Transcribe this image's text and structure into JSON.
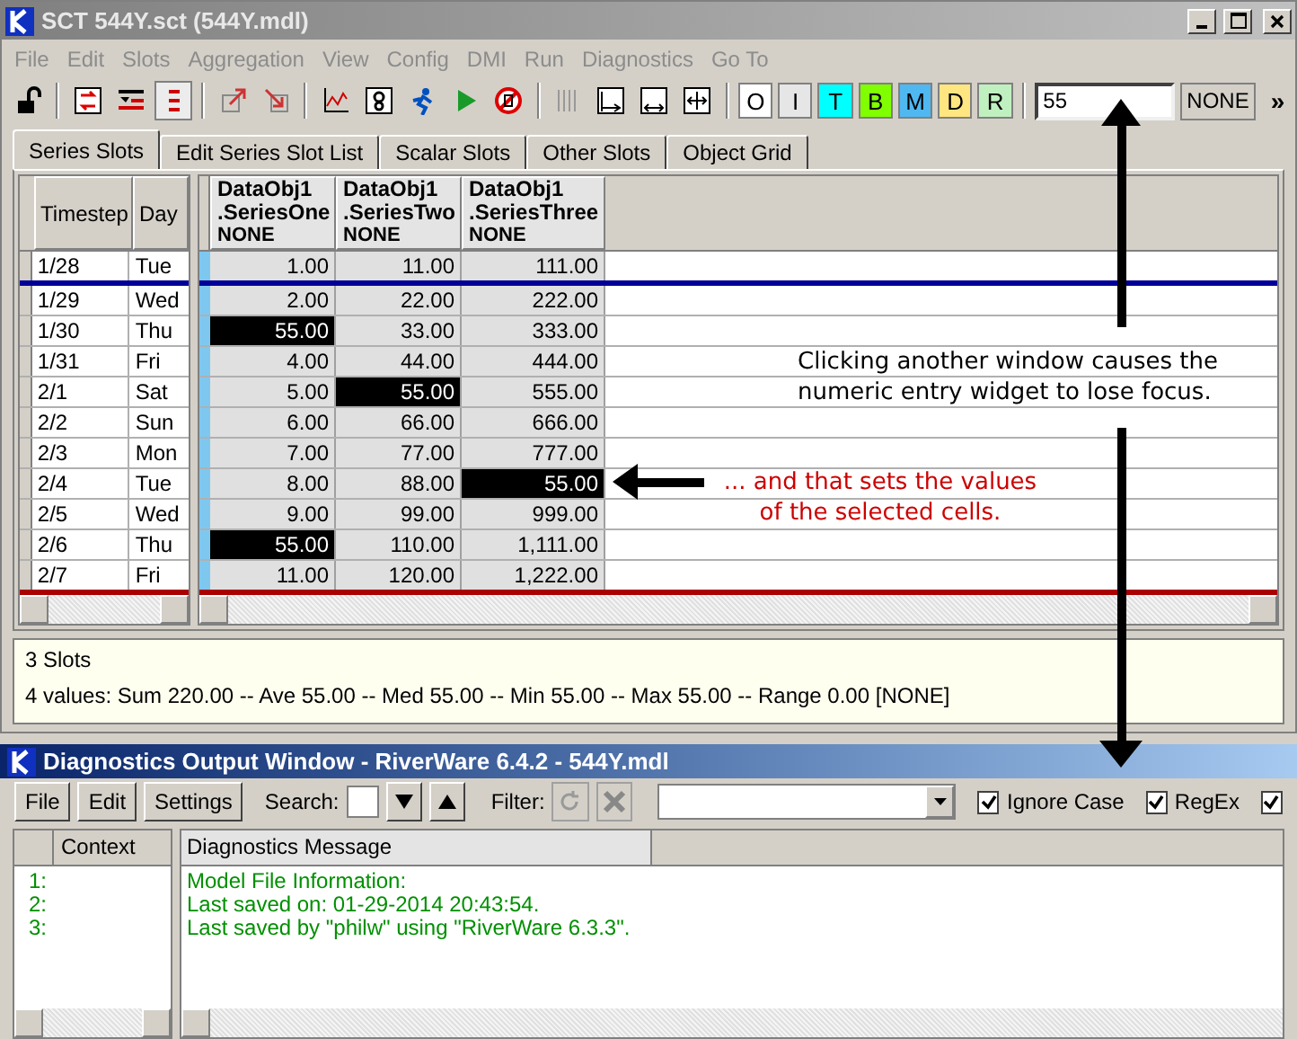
{
  "window": {
    "title": "SCT 544Y.sct (544Y.mdl)"
  },
  "menu": [
    {
      "label": "File",
      "disabled": true
    },
    {
      "label": "Edit",
      "disabled": true
    },
    {
      "label": "Slots",
      "disabled": true
    },
    {
      "label": "Aggregation",
      "disabled": true
    },
    {
      "label": "View",
      "disabled": true
    },
    {
      "label": "Config",
      "disabled": true
    },
    {
      "label": "DMI",
      "disabled": true
    },
    {
      "label": "Run",
      "disabled": true
    },
    {
      "label": "Diagnostics",
      "disabled": true
    },
    {
      "label": "Go To",
      "disabled": true
    }
  ],
  "flag_buttons": [
    {
      "label": "O",
      "color": "#ffffff"
    },
    {
      "label": "I",
      "color": "#e6e6e6"
    },
    {
      "label": "T",
      "color": "#00ffff"
    },
    {
      "label": "B",
      "color": "#80ff00"
    },
    {
      "label": "M",
      "color": "#4fb8f0"
    },
    {
      "label": "D",
      "color": "#ffe680"
    },
    {
      "label": "R",
      "color": "#c0f0c0"
    }
  ],
  "value_field": {
    "value": "55"
  },
  "units": "NONE",
  "overflow": "»",
  "tabs": [
    {
      "label": "Series Slots",
      "selected": true
    },
    {
      "label": "Edit Series Slot List",
      "selected": false
    },
    {
      "label": "Scalar Slots",
      "selected": false
    },
    {
      "label": "Other Slots",
      "selected": false
    },
    {
      "label": "Object Grid",
      "selected": false
    }
  ],
  "table": {
    "row_columns": [
      "Timestep",
      "Day"
    ],
    "series": [
      {
        "object": "DataObj1",
        "slot": ".SeriesOne",
        "units": "NONE"
      },
      {
        "object": "DataObj1",
        "slot": ".SeriesTwo",
        "units": "NONE"
      },
      {
        "object": "DataObj1",
        "slot": ".SeriesThree",
        "units": "NONE"
      }
    ],
    "rows": [
      {
        "timestep": "1/28",
        "day": "Tue",
        "values": [
          {
            "text": "1.00",
            "selected": false
          },
          {
            "text": "11.00",
            "selected": false
          },
          {
            "text": "111.00",
            "selected": false
          }
        ]
      },
      {
        "timestep": "1/29",
        "day": "Wed",
        "values": [
          {
            "text": "2.00",
            "selected": false
          },
          {
            "text": "22.00",
            "selected": false
          },
          {
            "text": "222.00",
            "selected": false
          }
        ]
      },
      {
        "timestep": "1/30",
        "day": "Thu",
        "values": [
          {
            "text": "55.00",
            "selected": true
          },
          {
            "text": "33.00",
            "selected": false
          },
          {
            "text": "333.00",
            "selected": false
          }
        ]
      },
      {
        "timestep": "1/31",
        "day": "Fri",
        "values": [
          {
            "text": "4.00",
            "selected": false
          },
          {
            "text": "44.00",
            "selected": false
          },
          {
            "text": "444.00",
            "selected": false
          }
        ]
      },
      {
        "timestep": "2/1",
        "day": "Sat",
        "values": [
          {
            "text": "5.00",
            "selected": false
          },
          {
            "text": "55.00",
            "selected": true
          },
          {
            "text": "555.00",
            "selected": false
          }
        ]
      },
      {
        "timestep": "2/2",
        "day": "Sun",
        "values": [
          {
            "text": "6.00",
            "selected": false
          },
          {
            "text": "66.00",
            "selected": false
          },
          {
            "text": "666.00",
            "selected": false
          }
        ]
      },
      {
        "timestep": "2/3",
        "day": "Mon",
        "values": [
          {
            "text": "7.00",
            "selected": false
          },
          {
            "text": "77.00",
            "selected": false
          },
          {
            "text": "777.00",
            "selected": false
          }
        ]
      },
      {
        "timestep": "2/4",
        "day": "Tue",
        "values": [
          {
            "text": "8.00",
            "selected": false
          },
          {
            "text": "88.00",
            "selected": false
          },
          {
            "text": "55.00",
            "selected": true
          }
        ]
      },
      {
        "timestep": "2/5",
        "day": "Wed",
        "values": [
          {
            "text": "9.00",
            "selected": false
          },
          {
            "text": "99.00",
            "selected": false
          },
          {
            "text": "999.00",
            "selected": false
          }
        ]
      },
      {
        "timestep": "2/6",
        "day": "Thu",
        "values": [
          {
            "text": "55.00",
            "selected": true
          },
          {
            "text": "110.00",
            "selected": false
          },
          {
            "text": "1,111.00",
            "selected": false
          }
        ]
      },
      {
        "timestep": "2/7",
        "day": "Fri",
        "values": [
          {
            "text": "11.00",
            "selected": false
          },
          {
            "text": "120.00",
            "selected": false
          },
          {
            "text": "1,222.00",
            "selected": false
          }
        ]
      }
    ]
  },
  "summary": [
    "3 Slots",
    "4 values:  Sum 220.00 -- Ave 55.00 -- Med 55.00 -- Min 55.00 -- Max 55.00 -- Range 0.00 [NONE]"
  ],
  "annotations": [
    {
      "kind": "note",
      "text": "Clicking another window causes the numeric entry widget to lose focus."
    },
    {
      "kind": "callout",
      "text": "... and that sets the values of the selected cells."
    }
  ],
  "diagnostics": {
    "title": "Diagnostics Output Window - RiverWare 6.4.2 - 544Y.mdl",
    "buttons": [
      "File",
      "Edit",
      "Settings"
    ],
    "search_label": "Search:",
    "filter_label": "Filter:",
    "checkboxes": [
      {
        "label": "Ignore Case",
        "checked": true
      },
      {
        "label": "RegEx",
        "checked": true
      },
      {
        "checked": true
      }
    ],
    "columns": [
      "Context",
      "Diagnostics Message"
    ],
    "lines": [
      {
        "number": "1:",
        "message": "Model File Information:"
      },
      {
        "number": "2:",
        "message": "Last saved on: 01-29-2014 20:43:54."
      },
      {
        "number": "3:",
        "message": "Last saved by \"philw\" using \"RiverWare 6.3.3\"."
      }
    ]
  }
}
